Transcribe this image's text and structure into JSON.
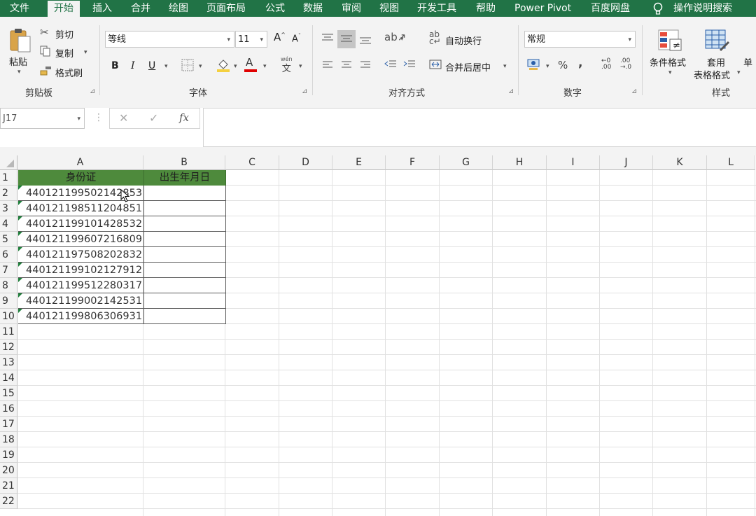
{
  "menu_tabs": [
    "文件",
    "开始",
    "插入",
    "合并",
    "绘图",
    "页面布局",
    "公式",
    "数据",
    "审阅",
    "视图",
    "开发工具",
    "帮助",
    "Power Pivot",
    "百度网盘",
    "操作说明搜索"
  ],
  "clipboard": {
    "paste": "粘贴",
    "cut": "剪切",
    "copy": "复制",
    "format_painter": "格式刷",
    "group": "剪贴板"
  },
  "font": {
    "name": "等线",
    "size": "11",
    "grow": "A",
    "shrink": "A",
    "bold": "B",
    "italic": "I",
    "underline": "U",
    "color_a": "A",
    "phonetic_top": "wén",
    "phonetic_bottom": "文",
    "group": "字体"
  },
  "alignment": {
    "wrap": "自动换行",
    "merge": "合并后居中",
    "group": "对齐方式"
  },
  "number": {
    "format": "常规",
    "percent": "%",
    "comma": ",",
    "inc_decimal_top": "←0",
    "inc_decimal_bottom": ".00",
    "dec_decimal_top": ".00",
    "dec_decimal_bottom": "→.0",
    "group": "数字"
  },
  "styles": {
    "conditional": "条件格式",
    "table_line1": "套用",
    "table_line2": "表格格式",
    "cell_partial": "单",
    "group": "样式"
  },
  "formula_bar": {
    "name_box": "J17",
    "cancel": "✕",
    "enter": "✓",
    "fx": "fx",
    "value": ""
  },
  "columns": [
    "A",
    "B",
    "C",
    "D",
    "E",
    "F",
    "G",
    "H",
    "I",
    "J",
    "K",
    "L"
  ],
  "rows": [
    "1",
    "2",
    "3",
    "4",
    "5",
    "6",
    "7",
    "8",
    "9",
    "10",
    "11",
    "12",
    "13",
    "14",
    "15",
    "16",
    "17",
    "18",
    "19",
    "20",
    "21",
    "22"
  ],
  "sheet": {
    "header_a": "身份证",
    "header_b": "出生年月日",
    "ids": [
      "440121199502142853",
      "440121198511204851",
      "440121199101428532",
      "440121199607216809",
      "440121197508202832",
      "440121199102127912",
      "440121199512280317",
      "440121199002142531",
      "440121199806306931"
    ]
  },
  "colors": {
    "ribbon_green": "#217346",
    "header_fill": "#4e8a3c",
    "font_color_bar": "#e00000",
    "fill_color_bar": "#f4d03f"
  }
}
